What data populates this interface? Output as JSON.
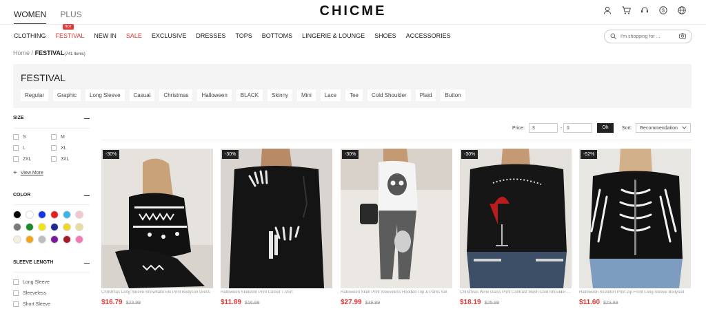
{
  "header": {
    "tabs": [
      "WOMEN",
      "PLUS"
    ],
    "logo": "CHICME",
    "icons": [
      "user-icon",
      "cart-icon",
      "support-icon",
      "currency-icon",
      "globe-icon"
    ]
  },
  "nav": {
    "items": [
      "CLOTHING",
      "FESTIVAL",
      "NEW IN",
      "SALE",
      "EXCLUSIVE",
      "DRESSES",
      "TOPS",
      "BOTTOMS",
      "LINGERIE & LOUNGE",
      "SHOES",
      "ACCESSORIES"
    ],
    "hot_badge": "HOT",
    "search_placeholder": "I'm shopping for ..."
  },
  "breadcrumb": {
    "home": "Home",
    "sep": "/",
    "current": "FESTIVAL",
    "count": "(741 Items)"
  },
  "festival": {
    "title": "FESTIVAL",
    "tags": [
      "Regular",
      "Graphic",
      "Long Sleeve",
      "Casual",
      "Christmas",
      "Halloween",
      "BLACK",
      "Skinny",
      "Mini",
      "Lace",
      "Tee",
      "Cold Shoulder",
      "Plaid",
      "Button"
    ]
  },
  "sidebar": {
    "size_title": "SIZE",
    "sizes": [
      "S",
      "M",
      "L",
      "XL",
      "2XL",
      "3XL"
    ],
    "view_more": "View More",
    "color_title": "COLOR",
    "colors": [
      "#000000",
      "#ffffff",
      "#1a33e6",
      "#e02020",
      "#3cb4e6",
      "#f4c6cf",
      "#7a7a7a",
      "#1d8a2a",
      "#f2e414",
      "#1e2a8c",
      "#f0d62a",
      "#e8dda0",
      "#f4efdc",
      "#f2a51a",
      "#bdbdbd",
      "#7a1a9a",
      "#a81a2a",
      "#f07ab4"
    ],
    "sleeve_title": "SLEEVE LENGTH",
    "sleeves": [
      "Long Sleeve",
      "Sleeveless",
      "Short Sleeve"
    ]
  },
  "toolbar": {
    "price_label": "Price:",
    "price_min": "$",
    "price_max": "$",
    "dash": "-",
    "ok": "Ok",
    "sort_label": "Sort:",
    "sort_value": "Recommendation"
  },
  "products": [
    {
      "discount": "-30%",
      "name": "Christmas Long Sleeve Snowflake Elk Print Bodycon Dress",
      "price": "$16.79",
      "old": "$23.99"
    },
    {
      "discount": "-30%",
      "name": "Halloween Skeleton Print Cutout T-shirt",
      "price": "$11.89",
      "old": "$16.99"
    },
    {
      "discount": "-30%",
      "name": "Halloween Skull Print Sleeveless Hooded Top & Pants Set",
      "price": "$27.99",
      "old": "$39.99"
    },
    {
      "discount": "-30%",
      "name": "Christmas Wine Glass Print Contrast Mesh Cold Shoulder Top",
      "price": "$18.19",
      "old": "$25.99"
    },
    {
      "discount": "-52%",
      "name": "Halloween Skeleton Print Zip Front Long Sleeve Bodysuit",
      "price": "$11.60",
      "old": "$23.99"
    }
  ]
}
